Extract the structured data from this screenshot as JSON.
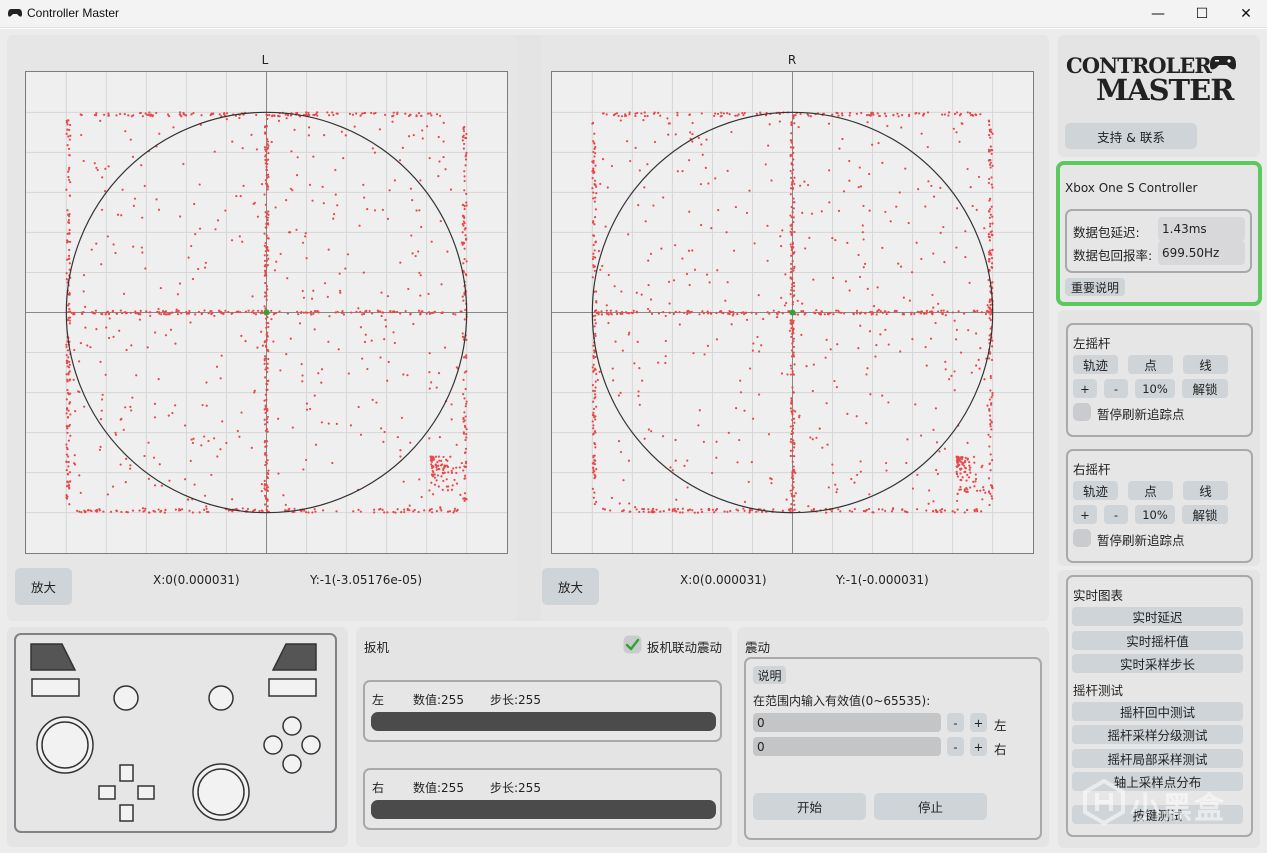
{
  "window": {
    "title": "Controller Master",
    "minimize": "—",
    "maximize": "☐",
    "close": "✕"
  },
  "plots": {
    "left": {
      "title": "L",
      "zoom_label": "放大",
      "x_readout": "X:0(0.000031)",
      "y_readout": "Y:-1(-3.05176e-05)"
    },
    "right": {
      "title": "R",
      "zoom_label": "放大",
      "x_readout": "X:0(0.000031)",
      "y_readout": "Y:-1(-0.000031)"
    }
  },
  "logo": {
    "line1": "CONTROLER",
    "line2": "MASTER"
  },
  "support_label": "支持 & 联系",
  "device": {
    "name": "Xbox One S Controller",
    "latency_label": "数据包延迟:",
    "latency_value": "1.43ms",
    "rate_label": "数据包回报率:",
    "rate_value": "699.50Hz",
    "notice_label": "重要说明"
  },
  "left_stick": {
    "title": "左摇杆",
    "trail": "轨迹",
    "dot": "点",
    "line": "线",
    "plus": "+",
    "minus": "-",
    "percent": "10%",
    "unlock": "解锁",
    "pause": "暂停刷新追踪点"
  },
  "right_stick": {
    "title": "右摇杆",
    "trail": "轨迹",
    "dot": "点",
    "line": "线",
    "plus": "+",
    "minus": "-",
    "percent": "10%",
    "unlock": "解锁",
    "pause": "暂停刷新追踪点"
  },
  "realtime": {
    "title": "实时图表",
    "items": [
      "实时延迟",
      "实时摇杆值",
      "实时采样步长"
    ],
    "test_title": "摇杆测试",
    "tests": [
      "摇杆回中测试",
      "摇杆采样分级测试",
      "摇杆局部采样测试",
      "轴上采样点分布",
      "按键测试"
    ]
  },
  "trigger": {
    "title": "扳机",
    "link_label": "扳机联动震动",
    "link_checked": true,
    "left": {
      "side": "左",
      "value": "数值:255",
      "step": "步长:255",
      "fill": 1.0
    },
    "right": {
      "side": "右",
      "value": "数值:255",
      "step": "步长:255",
      "fill": 1.0
    }
  },
  "vibration": {
    "title": "震动",
    "help": "说明",
    "hint": "在范围内输入有效值(0~65535):",
    "left_value": "0",
    "right_value": "0",
    "minus": "-",
    "plus": "+",
    "left_label": "左",
    "right_label": "右",
    "start": "开始",
    "stop": "停止"
  },
  "watermark": "小黑盒",
  "colors": {
    "accent_green": "#5cc85e",
    "trace_red": "#e94848",
    "center_green": "#2ea52e"
  }
}
